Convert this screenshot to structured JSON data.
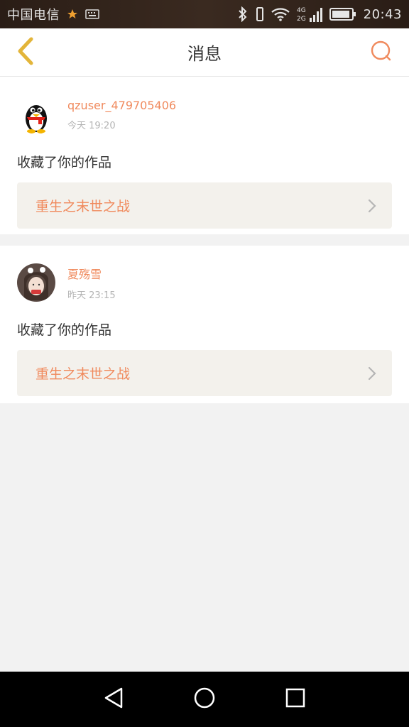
{
  "status_bar": {
    "carrier": "中国电信",
    "network": "4G 2G",
    "time": "20:43"
  },
  "header": {
    "back_icon": "chevron-left-icon",
    "title": "消息",
    "action_icon": "chat-bubble-icon"
  },
  "messages": [
    {
      "username": "qzuser_479705406",
      "timestamp": "今天 19:20",
      "action": "收藏了你的作品",
      "work_title": "重生之末世之战"
    },
    {
      "username": "夏殇雪",
      "timestamp": "昨天 23:15",
      "action": "收藏了你的作品",
      "work_title": "重生之末世之战"
    }
  ],
  "colors": {
    "accent": "#f08a5d",
    "back_chevron": "#e3b53a",
    "card_link_bg": "#f3f1ec",
    "page_bg": "#f2f2f2"
  }
}
